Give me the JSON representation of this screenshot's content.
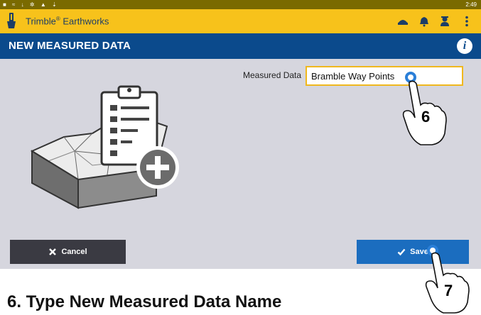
{
  "status_bar": {
    "icons": [
      "notification-icon",
      "wifi-icon",
      "location-icon",
      "settings-icon",
      "warning-icon",
      "download-icon"
    ],
    "time": "2:49"
  },
  "app_bar": {
    "app_name": "Trimble",
    "registered_mark": "®",
    "app_suffix": " Earthworks",
    "actions": [
      "machine-icon",
      "alert-bell-icon",
      "operator-icon",
      "more-vert-icon"
    ]
  },
  "header": {
    "title": "NEW MEASURED DATA",
    "info_label": "i"
  },
  "form": {
    "label": "Measured Data",
    "value": "Bramble Way Points"
  },
  "buttons": {
    "cancel": "Cancel",
    "save": "Save"
  },
  "callouts": {
    "step_6": "6",
    "step_7": "7"
  },
  "caption": "6. Type New Measured Data Name",
  "colors": {
    "status_bar": "#7a6a00",
    "app_bar": "#f7c21b",
    "header": "#0b4a8c",
    "content_bg": "#d6d6de",
    "cancel_bg": "#3a3a42",
    "save_bg": "#1b6dbf",
    "input_border": "#f0b81e",
    "tap_ring": "#2a7fd8"
  }
}
